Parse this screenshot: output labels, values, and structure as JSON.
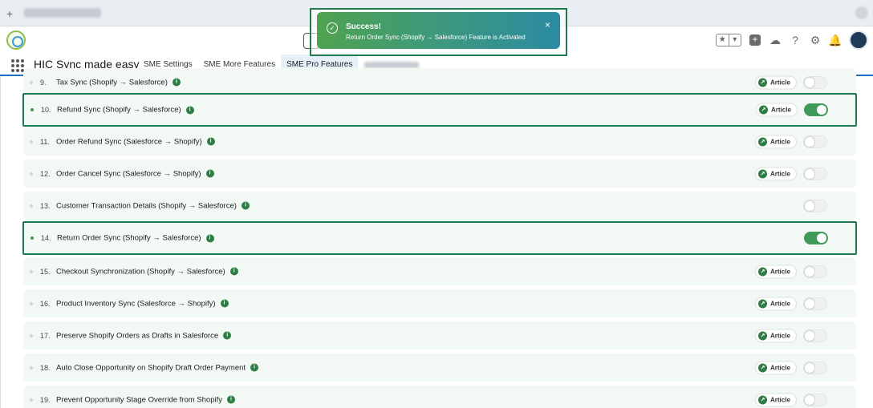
{
  "header": {
    "app_name": "HIC Sync made easy",
    "fav_star": "★",
    "fav_caret": "▾",
    "icons": [
      "plus-square-icon",
      "trailhead-icon",
      "help-icon",
      "gear-icon",
      "bell-icon",
      "avatar"
    ]
  },
  "nav": {
    "tabs": [
      {
        "label": "SME Settings",
        "active": false
      },
      {
        "label": "SME More Features",
        "active": false
      },
      {
        "label": "SME Pro Features",
        "active": true
      },
      {
        "label": "",
        "active": false,
        "blurred": true
      }
    ]
  },
  "toast": {
    "title": "Success!",
    "message": "Return Order Sync (Shopify → Salesforce) Feature is Activated",
    "close": "×"
  },
  "article_label": "Article",
  "features": [
    {
      "num": "9.",
      "name": "Tax Sync (Shopify → Salesforce)",
      "info": true,
      "article": true,
      "enabled": false
    },
    {
      "num": "10.",
      "name": "Refund Sync (Shopify → Salesforce)",
      "info": true,
      "article": true,
      "enabled": true
    },
    {
      "num": "11.",
      "name": "Order Refund Sync (Salesforce → Shopify)",
      "info": true,
      "article": true,
      "enabled": false
    },
    {
      "num": "12.",
      "name": "Order Cancel Sync (Salesforce → Shopify)",
      "info": true,
      "article": true,
      "enabled": false
    },
    {
      "num": "13.",
      "name": "Customer Transaction Details (Shopify → Salesforce)",
      "info": true,
      "article": false,
      "enabled": false
    },
    {
      "num": "14.",
      "name": "Return Order Sync (Shopify → Salesforce)",
      "info": true,
      "article": false,
      "enabled": true
    },
    {
      "num": "15.",
      "name": "Checkout Synchronization (Shopify → Salesforce)",
      "info": true,
      "article": true,
      "enabled": false
    },
    {
      "num": "16.",
      "name": "Product Inventory Sync (Salesforce → Shopify)",
      "info": true,
      "article": true,
      "enabled": false
    },
    {
      "num": "17.",
      "name": "Preserve Shopify Orders as Drafts in Salesforce",
      "info": true,
      "article": true,
      "enabled": false
    },
    {
      "num": "18.",
      "name": "Auto Close Opportunity on Shopify Draft Order Payment",
      "info": true,
      "article": true,
      "enabled": false
    },
    {
      "num": "19.",
      "name": "Prevent Opportunity Stage Override from Shopify",
      "info": true,
      "article": true,
      "enabled": false
    }
  ],
  "highlighted_rows": [
    "10.",
    "14."
  ],
  "colors": {
    "accent": "#1b6fc1",
    "success": "#3f9a57",
    "highlight_border": "#1f7a4d"
  }
}
